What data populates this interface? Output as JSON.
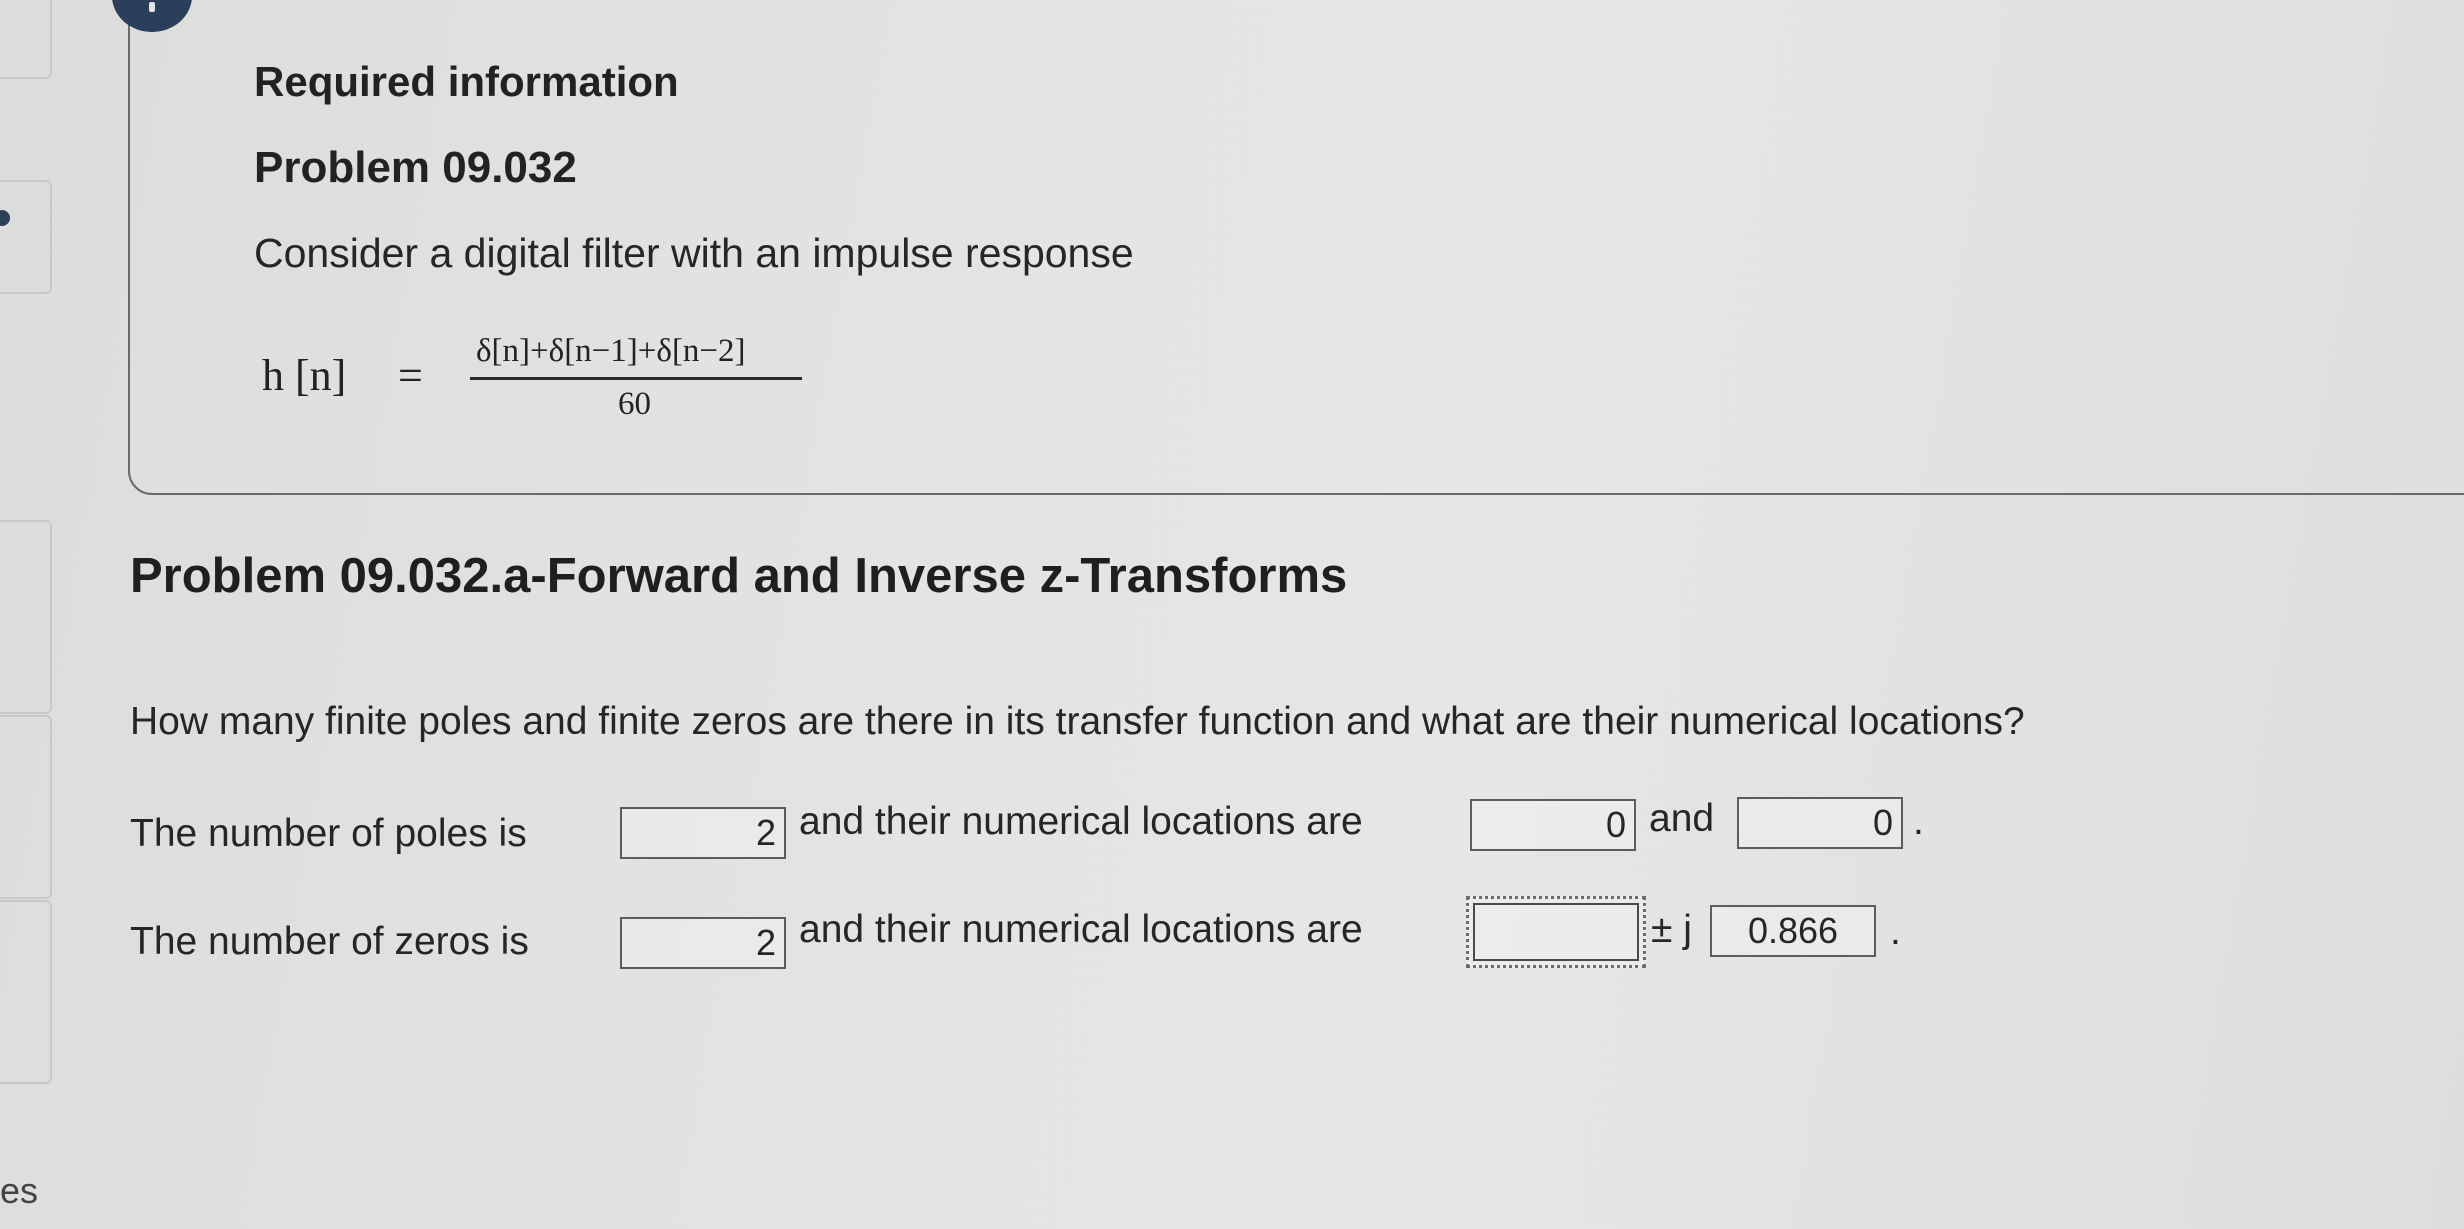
{
  "left_rail": {
    "bottom_text": "es"
  },
  "info_card": {
    "heading": "Required information",
    "problem_title": "Problem 09.032",
    "intro": "Consider a digital filter with an impulse response",
    "equation": {
      "lhs": "h [n]",
      "equals": "=",
      "numerator": "δ[n]+δ[n−1]+δ[n−2]",
      "denominator": "60"
    }
  },
  "part": {
    "title": "Problem 09.032.a-Forward and Inverse z-Transforms",
    "question": "How many finite poles and finite zeros are there in its transfer function and what are their numerical locations?"
  },
  "poles_row": {
    "label": "The number of poles is",
    "count_value": "2",
    "locations_label": "and their numerical locations are",
    "location1_value": "0",
    "and_text": "and",
    "location2_value": "0",
    "end": "."
  },
  "zeros_row": {
    "label": "The number of zeros is",
    "count_value": "2",
    "locations_label": "and their numerical locations are",
    "real_value": "",
    "pm_j": "± j",
    "imag_value": "0.866",
    "end": "."
  }
}
